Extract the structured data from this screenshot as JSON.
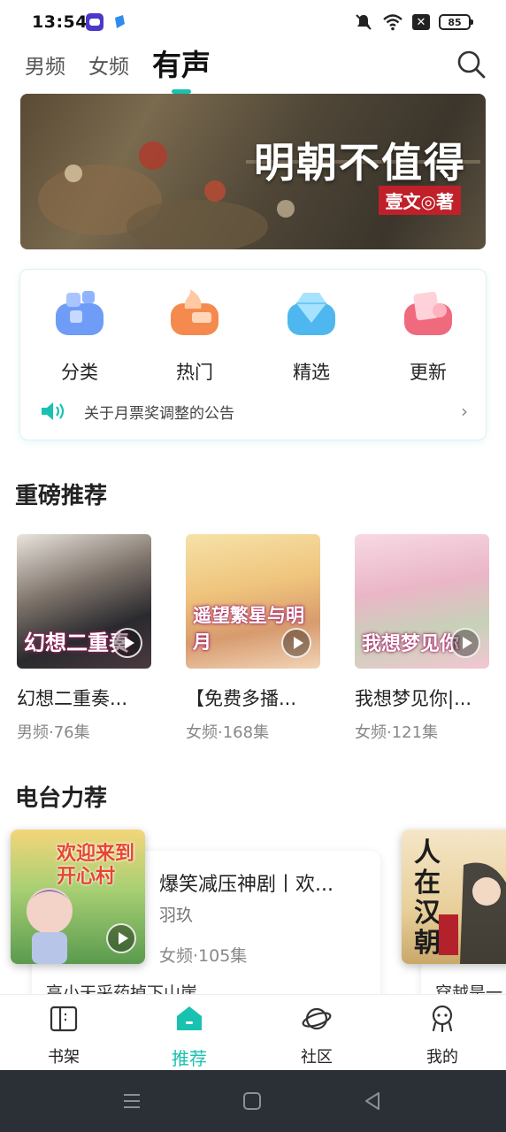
{
  "status_bar": {
    "time": "13:54",
    "battery": "85"
  },
  "top_tabs": [
    {
      "label": "男频",
      "active": false
    },
    {
      "label": "女频",
      "active": false
    },
    {
      "label": "有声",
      "active": true
    }
  ],
  "banner": {
    "title": "明朝不值得",
    "author": "壹文◎著"
  },
  "quick_links": [
    {
      "label": "分类",
      "icon": "category-icon"
    },
    {
      "label": "热门",
      "icon": "hot-icon"
    },
    {
      "label": "精选",
      "icon": "diamond-icon"
    },
    {
      "label": "更新",
      "icon": "update-icon"
    }
  ],
  "notice": {
    "text": "关于月票奖调整的公告"
  },
  "featured": {
    "title": "重磅推荐",
    "books": [
      {
        "title": "幻想二重奏...",
        "meta": "男频·76集",
        "cover_text": "幻想二重奏"
      },
      {
        "title": "【免费多播...",
        "meta": "女频·168集",
        "cover_text": "遥望繁星与明月"
      },
      {
        "title": "我想梦见你|...",
        "meta": "女频·121集",
        "cover_text": "我想梦见你"
      }
    ]
  },
  "radio": {
    "title": "电台力荐",
    "items": [
      {
        "title": "爆笑减压神剧丨欢...",
        "author": "羽玖",
        "meta": "女频·105集",
        "peek": "高小天采药掉下山崖",
        "cover_text": "欢迎来到开心村"
      },
      {
        "peek": "穿越是一",
        "cover_text": "人在汉朝"
      }
    ]
  },
  "bottom_nav": [
    {
      "label": "书架",
      "active": false
    },
    {
      "label": "推荐",
      "active": true
    },
    {
      "label": "社区",
      "active": false
    },
    {
      "label": "我的",
      "active": false
    }
  ],
  "colors": {
    "accent": "#19c2b0"
  }
}
